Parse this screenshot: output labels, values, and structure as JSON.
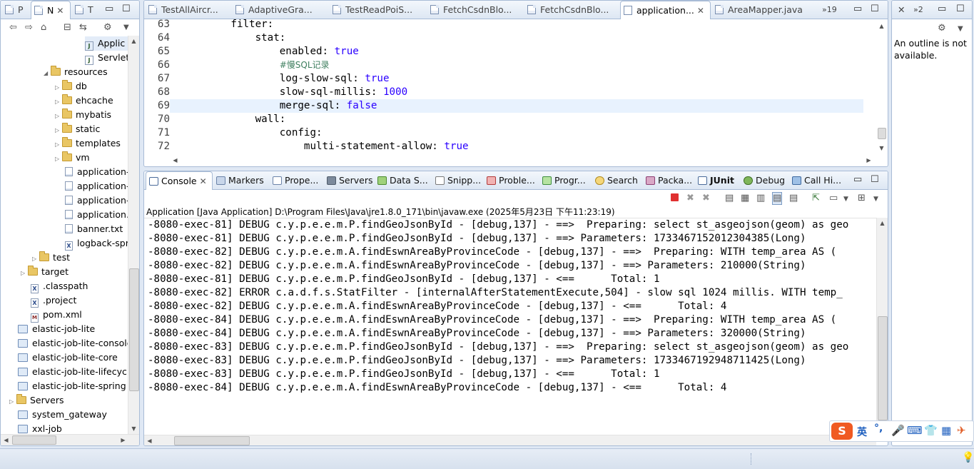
{
  "explorer": {
    "tabs": [
      "P",
      "N",
      "T"
    ],
    "items": [
      {
        "label": "Applic",
        "type": "java"
      },
      {
        "label": "Servlet",
        "type": "java"
      },
      {
        "label": "resources",
        "type": "folder-open"
      },
      {
        "label": "db",
        "type": "folder"
      },
      {
        "label": "ehcache",
        "type": "folder"
      },
      {
        "label": "mybatis",
        "type": "folder"
      },
      {
        "label": "static",
        "type": "folder"
      },
      {
        "label": "templates",
        "type": "folder"
      },
      {
        "label": "vm",
        "type": "folder"
      },
      {
        "label": "application-",
        "type": "file"
      },
      {
        "label": "application-",
        "type": "file"
      },
      {
        "label": "application-",
        "type": "file"
      },
      {
        "label": "application.",
        "type": "file"
      },
      {
        "label": "banner.txt",
        "type": "file"
      },
      {
        "label": "logback-spr",
        "type": "xfile"
      },
      {
        "label": "test",
        "type": "folder"
      },
      {
        "label": "target",
        "type": "folder"
      },
      {
        "label": ".classpath",
        "type": "xfile"
      },
      {
        "label": ".project",
        "type": "xfile"
      },
      {
        "label": "pom.xml",
        "type": "mfile"
      },
      {
        "label": "elastic-job-lite",
        "type": "project"
      },
      {
        "label": "elastic-job-lite-console",
        "type": "project"
      },
      {
        "label": "elastic-job-lite-core",
        "type": "project"
      },
      {
        "label": "elastic-job-lite-lifecycle",
        "type": "project"
      },
      {
        "label": "elastic-job-lite-spring",
        "type": "project"
      },
      {
        "label": "Servers",
        "type": "folder"
      },
      {
        "label": "system_gateway",
        "type": "project"
      },
      {
        "label": "xxl-job",
        "type": "project"
      }
    ]
  },
  "editor": {
    "tabs": [
      {
        "label": "TestAllAircr..."
      },
      {
        "label": "AdaptiveGra..."
      },
      {
        "label": "TestReadPoiS..."
      },
      {
        "label": "FetchCsdnBlo..."
      },
      {
        "label": "FetchCsdnBlo..."
      },
      {
        "label": "application...",
        "active": true
      },
      {
        "label": "AreaMapper.java"
      }
    ],
    "overflow": "»19",
    "lines": [
      {
        "no": "63",
        "indent": "          ",
        "key": "filter:",
        "value": ""
      },
      {
        "no": "64",
        "indent": "              ",
        "key": "stat:",
        "value": ""
      },
      {
        "no": "65",
        "indent": "                  ",
        "key": "enabled: ",
        "value": "true"
      },
      {
        "no": "66",
        "indent": "                  ",
        "key": "",
        "value": "",
        "comment": "#慢SQL记录"
      },
      {
        "no": "67",
        "indent": "                  ",
        "key": "log-slow-sql: ",
        "value": "true"
      },
      {
        "no": "68",
        "indent": "                  ",
        "key": "slow-sql-millis: ",
        "value": "1000"
      },
      {
        "no": "69",
        "indent": "                  ",
        "key": "merge-sql: ",
        "value": "false"
      },
      {
        "no": "70",
        "indent": "              ",
        "key": "wall:",
        "value": ""
      },
      {
        "no": "71",
        "indent": "                  ",
        "key": "config:",
        "value": ""
      },
      {
        "no": "72",
        "indent": "                      ",
        "key": "multi-statement-allow: ",
        "value": "true"
      }
    ]
  },
  "outline": {
    "tab_count": "»2",
    "message": "An outline is not available."
  },
  "console": {
    "tabs": [
      {
        "label": "Console",
        "active": true
      },
      {
        "label": "Markers"
      },
      {
        "label": "Prope..."
      },
      {
        "label": "Servers"
      },
      {
        "label": "Data S..."
      },
      {
        "label": "Snipp..."
      },
      {
        "label": "Proble..."
      },
      {
        "label": "Progr..."
      },
      {
        "label": "Search"
      },
      {
        "label": "Packa..."
      },
      {
        "label": "JUnit"
      },
      {
        "label": "Debug"
      },
      {
        "label": "Call Hi..."
      }
    ],
    "header": "Application [Java Application] D:\\Program Files\\Java\\jre1.8.0_171\\bin\\javaw.exe (2025年5月23日 下午11:23:19)",
    "lines": [
      "-8080-exec-81] DEBUG c.y.p.e.e.m.P.findGeoJsonById - [debug,137] - ==>  Preparing: select st_asgeojson(geom) as geo",
      "-8080-exec-81] DEBUG c.y.p.e.e.m.P.findGeoJsonById - [debug,137] - ==> Parameters: 1733467152012304385(Long)",
      "-8080-exec-82] DEBUG c.y.p.e.e.m.A.findEswnAreaByProvinceCode - [debug,137] - ==>  Preparing: WITH temp_area AS (",
      "-8080-exec-82] DEBUG c.y.p.e.e.m.A.findEswnAreaByProvinceCode - [debug,137] - ==> Parameters: 210000(String)",
      "-8080-exec-81] DEBUG c.y.p.e.e.m.P.findGeoJsonById - [debug,137] - <==      Total: 1",
      "-8080-exec-82] ERROR c.a.d.f.s.StatFilter - [internalAfterStatementExecute,504] - slow sql 1024 millis. WITH temp_",
      "-8080-exec-82] DEBUG c.y.p.e.e.m.A.findEswnAreaByProvinceCode - [debug,137] - <==      Total: 4",
      "-8080-exec-84] DEBUG c.y.p.e.e.m.A.findEswnAreaByProvinceCode - [debug,137] - ==>  Preparing: WITH temp_area AS (",
      "-8080-exec-84] DEBUG c.y.p.e.e.m.A.findEswnAreaByProvinceCode - [debug,137] - ==> Parameters: 320000(String)",
      "-8080-exec-83] DEBUG c.y.p.e.e.m.P.findGeoJsonById - [debug,137] - ==>  Preparing: select st_asgeojson(geom) as geo",
      "-8080-exec-83] DEBUG c.y.p.e.e.m.P.findGeoJsonById - [debug,137] - ==> Parameters: 1733467192948711425(Long)",
      "-8080-exec-83] DEBUG c.y.p.e.e.m.P.findGeoJsonById - [debug,137] - <==      Total: 1",
      "-8080-exec-84] DEBUG c.y.p.e.e.m.A.findEswnAreaByProvinceCode - [debug,137] - <==      Total: 4"
    ]
  },
  "ime": {
    "lang": "英",
    "punct": "°,"
  },
  "colors": {
    "accent": "#2a00ff",
    "frame": "#a9bcd6",
    "background": "#dfe8f4"
  }
}
